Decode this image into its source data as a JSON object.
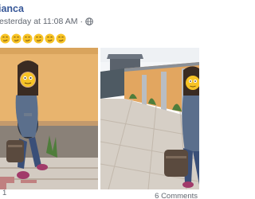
{
  "post": {
    "author": "ianca",
    "timestamp": "esterday at 11:08 AM",
    "separator": "·",
    "privacy_icon": "globe-icon",
    "text_emojis": [
      "smirk-face-emoji",
      "smirk-face-emoji",
      "smirk-face-emoji",
      "smirk-face-emoji",
      "smirk-face-emoji",
      "smirk-face-emoji"
    ],
    "photos": [
      {
        "subject": "photo-girl-leaning-on-wall"
      },
      {
        "subject": "photo-girl-in-courtyard"
      }
    ]
  },
  "footer": {
    "reactions_count": "1",
    "comments": "6 Comments"
  },
  "colors": {
    "author_link": "#385898",
    "meta_text": "#616770",
    "wall": "#e8b46e",
    "emoji": "#f7c325"
  }
}
